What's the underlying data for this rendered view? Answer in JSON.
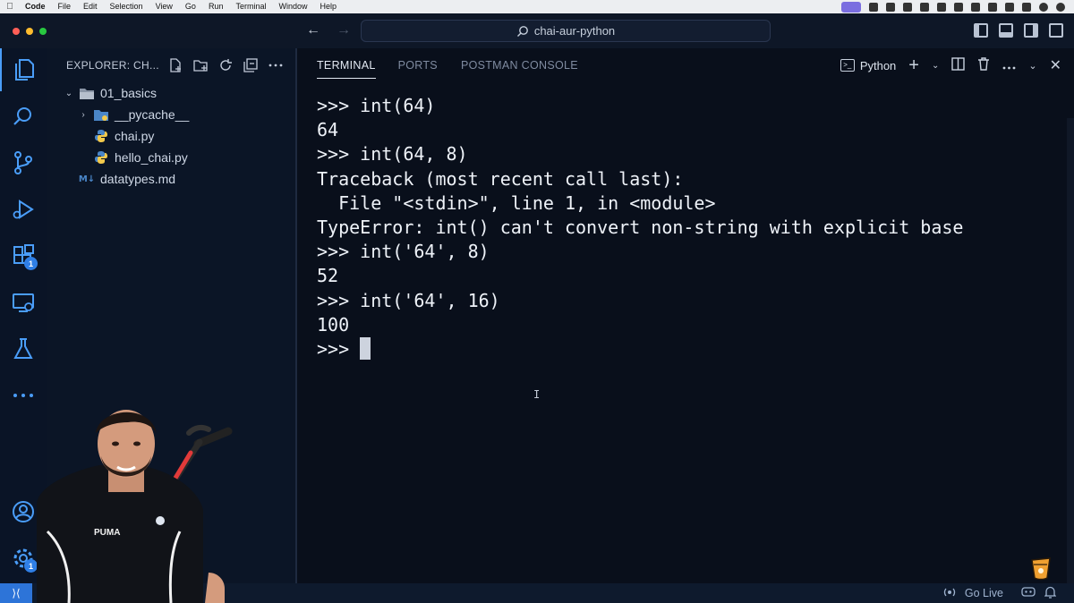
{
  "menubar": {
    "app_name": "Code",
    "items": [
      "File",
      "Edit",
      "Selection",
      "View",
      "Go",
      "Run",
      "Terminal",
      "Window",
      "Help"
    ]
  },
  "titlebar": {
    "search_text": "chai-aur-python"
  },
  "activity_bar": {
    "extensions_badge": "1",
    "settings_badge": "1"
  },
  "sidebar": {
    "title": "EXPLORER: CH...",
    "tree": [
      {
        "label": "01_basics",
        "type": "folder-open",
        "depth": 0
      },
      {
        "label": "__pycache__",
        "type": "folder",
        "depth": 1
      },
      {
        "label": "chai.py",
        "type": "python",
        "depth": 1
      },
      {
        "label": "hello_chai.py",
        "type": "python",
        "depth": 1
      },
      {
        "label": "datatypes.md",
        "type": "markdown",
        "depth": 0
      }
    ]
  },
  "panel": {
    "tabs": [
      "TERMINAL",
      "PORTS",
      "POSTMAN CONSOLE"
    ],
    "active_tab": "TERMINAL",
    "terminal_profile": "Python"
  },
  "terminal": {
    "lines": [
      ">>> int(64)",
      "64",
      ">>> int(64, 8)",
      "Traceback (most recent call last):",
      "  File \"<stdin>\", line 1, in <module>",
      "TypeError: int() can't convert non-string with explicit base",
      ">>> int('64', 8)",
      "52",
      ">>> int('64', 16)",
      "100"
    ],
    "prompt": ">>> "
  },
  "statusbar": {
    "go_live": "Go Live"
  },
  "overlay": {
    "shirt_brand": "PUMA"
  },
  "colors": {
    "accent": "#4a9df8",
    "badge": "#2f7fe6",
    "python_blue": "#4a86c8",
    "python_yellow": "#f2c94c",
    "markdown": "#4a86c8"
  }
}
